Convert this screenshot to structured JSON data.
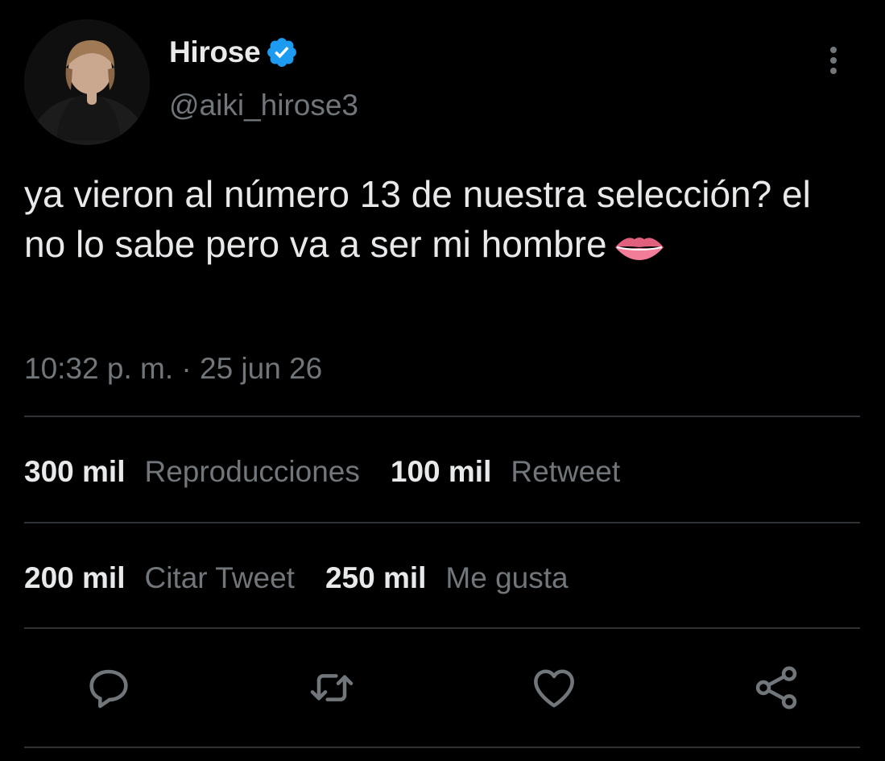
{
  "author": {
    "display_name": "Hirose",
    "handle": "@aiki_hirose3",
    "verified": true,
    "avatar_icon": "avatar-photo"
  },
  "tweet": {
    "text": "ya vieron al número 13 de nuestra selección? el no lo sabe pero va a ser mi hombre",
    "emoji_icon": "lips-emoji",
    "timestamp": "10:32 p. m. · 25 jun 26"
  },
  "stats": [
    {
      "value": "300 mil",
      "label": "Reproducciones"
    },
    {
      "value": "100 mil",
      "label": "Retweet"
    },
    {
      "value": "200 mil",
      "label": "Citar Tweet"
    },
    {
      "value": "250 mil",
      "label": "Me gusta"
    }
  ],
  "actions": [
    "reply-icon",
    "retweet-icon",
    "like-icon",
    "share-icon"
  ],
  "colors": {
    "background": "#000000",
    "text_primary": "#e7e9ea",
    "text_secondary": "#71767b",
    "divider": "#2f3336",
    "verified_blue": "#1d9bf0"
  }
}
